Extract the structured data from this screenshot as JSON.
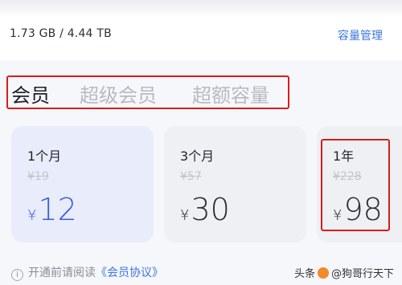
{
  "storage": {
    "usage": "1.73 GB / 4.44 TB",
    "manage_label": "容量管理"
  },
  "tabs": [
    {
      "label": "会员",
      "active": true
    },
    {
      "label": "超级会员",
      "active": false
    },
    {
      "label": "超额容量",
      "active": false
    }
  ],
  "plans": [
    {
      "period": "1个月",
      "original_price": "¥19",
      "currency": "¥",
      "price": "12",
      "selected": true
    },
    {
      "period": "3个月",
      "original_price": "¥57",
      "currency": "¥",
      "price": "30",
      "selected": false
    },
    {
      "period": "1年",
      "original_price": "¥228",
      "currency": "¥",
      "price": "98",
      "selected": false
    }
  ],
  "agreement": {
    "prefix": "开通前请阅读",
    "link": "《会员协议》"
  },
  "watermark": {
    "text1": "头条",
    "text2": "@狗哥行天下"
  },
  "colors": {
    "accent": "#3b76e1",
    "price_selected": "#3a5ee0",
    "highlight_box": "#d61d1d"
  }
}
